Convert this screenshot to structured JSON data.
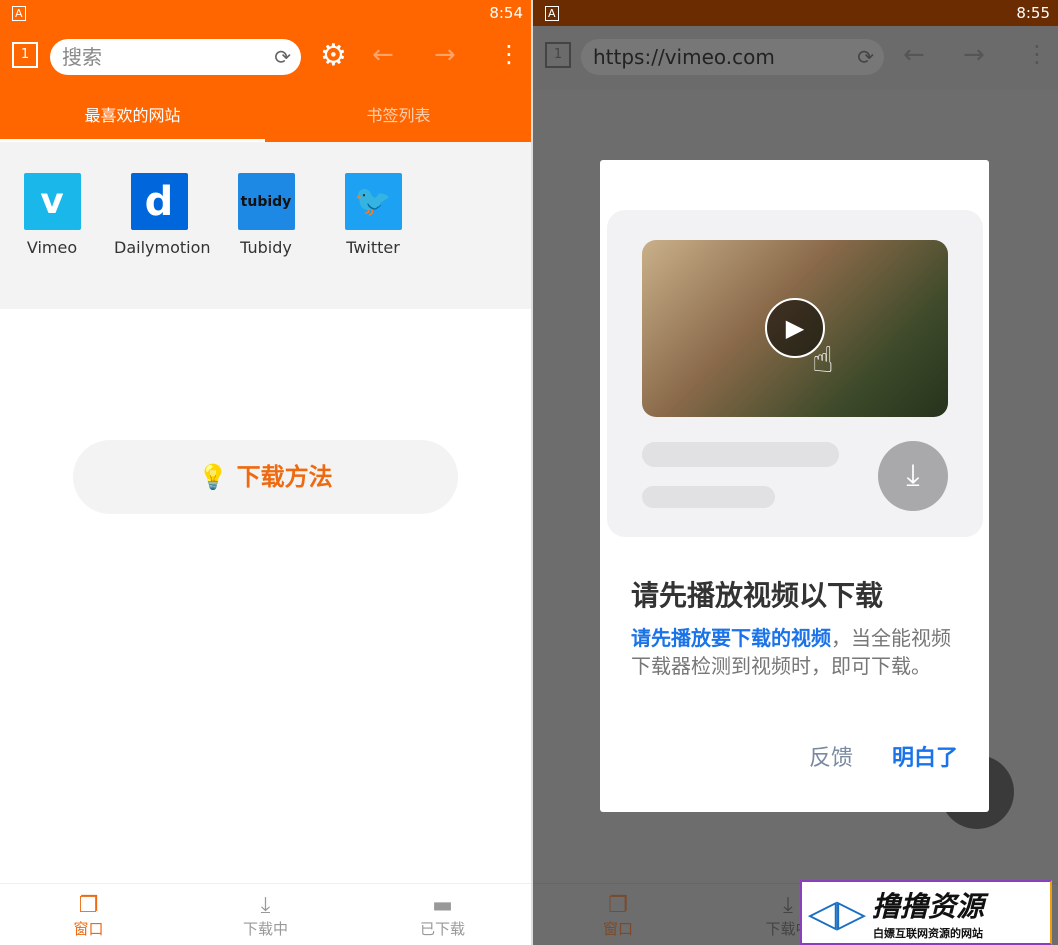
{
  "colors": {
    "accent": "#ff6600",
    "link": "#1a73e8"
  },
  "left": {
    "status": {
      "time": "8:54"
    },
    "toolbar": {
      "tab_count": "1",
      "search_placeholder": "搜索"
    },
    "tabs": [
      "最喜欢的网站",
      "书签列表"
    ],
    "favorites": [
      {
        "label": "Vimeo",
        "glyph": "v",
        "color": "#1ab7ea"
      },
      {
        "label": "Dailymotion",
        "glyph": "d",
        "color": "#0066dc"
      },
      {
        "label": "Tubidy",
        "glyph": "tubidy",
        "color": "#1e88e5"
      },
      {
        "label": "Twitter",
        "glyph": "🐦",
        "color": "#1da1f2"
      }
    ],
    "howto_label": "下载方法",
    "bottom_nav": [
      "窗口",
      "下载中",
      "已下载"
    ]
  },
  "right": {
    "status": {
      "time": "8:55"
    },
    "toolbar": {
      "tab_count": "1",
      "url": "https://vimeo.com"
    },
    "dialog": {
      "title": "请先播放视频以下载",
      "body_highlight": "请先播放要下载的视频",
      "body_rest": "，当全能视频下载器检测到视频时，即可下载。",
      "feedback": "反馈",
      "ok": "明白了"
    },
    "bottom_nav": [
      "窗口",
      "下载中"
    ]
  },
  "watermark": {
    "title": "撸撸资源",
    "subtitle": "白嫖互联网资源的网站"
  }
}
